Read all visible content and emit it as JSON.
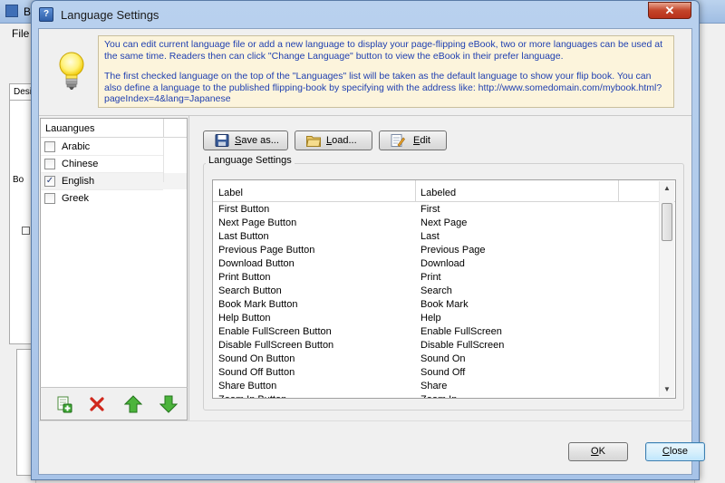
{
  "app": {
    "title": "B",
    "menu_file": "File",
    "tab_label": "Desi",
    "tree_label": "Bo"
  },
  "dialog": {
    "title": "Language Settings",
    "close_glyph": "✕",
    "info": {
      "line1": "You can edit current language file or add a new language to display your page-flipping eBook, two or more languages can be used at the same time. Readers then can click \"Change Language\" button to view the eBook in their prefer language.",
      "line2": "The first checked language on the top of the \"Languages\" list will be taken as the default language to show your flip book. You can also define a language to the published flipping-book by specifying with the address like: http://www.somedomain.com/mybook.html?pageIndex=4&lang=Japanese"
    },
    "languages": {
      "header": "Lauangues",
      "items": [
        {
          "name": "Arabic",
          "checked": false,
          "check": ""
        },
        {
          "name": "Chinese",
          "checked": false,
          "check": ""
        },
        {
          "name": "English",
          "checked": true,
          "check": "✓"
        },
        {
          "name": "Greek",
          "checked": false,
          "check": ""
        }
      ]
    },
    "toolbar": {
      "save_prefix": "",
      "save_u": "S",
      "save_rest": "ave as...",
      "load_u": "L",
      "load_rest": "oad...",
      "edit_u": "E",
      "edit_rest": "dit"
    },
    "group_label": "Language Settings",
    "grid": {
      "columns": [
        "Label",
        "Labeled"
      ],
      "rows": [
        [
          "First Button",
          "First"
        ],
        [
          "Next Page Button",
          "Next Page"
        ],
        [
          "Last Button",
          "Last"
        ],
        [
          "Previous Page Button",
          "Previous Page"
        ],
        [
          "Download Button",
          "Download"
        ],
        [
          "Print Button",
          "Print"
        ],
        [
          "Search Button",
          "Search"
        ],
        [
          "Book Mark Button",
          "Book Mark"
        ],
        [
          "Help Button",
          "Help"
        ],
        [
          "Enable FullScreen Button",
          "Enable FullScreen"
        ],
        [
          "Disable FullScreen Button",
          "Disable FullScreen"
        ],
        [
          "Sound On Button",
          "Sound On"
        ],
        [
          "Sound Off Button",
          "Sound Off"
        ],
        [
          "Share Button",
          "Share"
        ],
        [
          "Zoom In Button",
          "Zoom In"
        ]
      ]
    },
    "footer": {
      "ok_u": "O",
      "ok_rest": "K",
      "close_u": "C",
      "close_rest": "lose"
    },
    "scroll_up": "▲",
    "scroll_down": "▼"
  },
  "icons": [
    "lightbulb-icon",
    "add-icon",
    "delete-icon",
    "move-up-icon",
    "move-down-icon",
    "floppy-save-icon",
    "folder-load-icon",
    "edit-icon"
  ]
}
